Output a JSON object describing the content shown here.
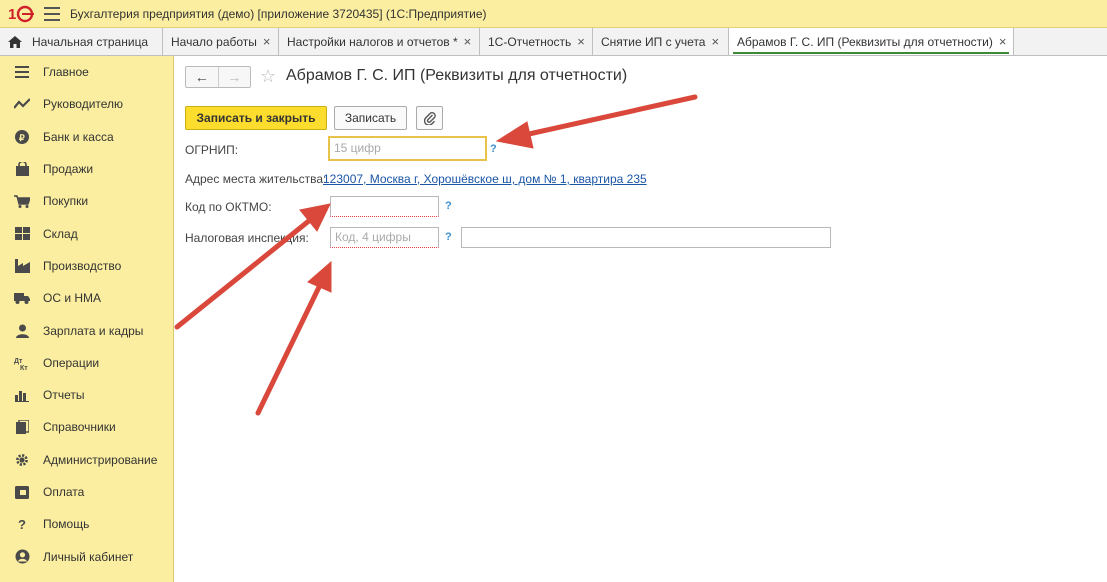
{
  "app": {
    "title": "Бухгалтерия предприятия (демо) [приложение 3720435]  (1С:Предприятие)"
  },
  "tabs": [
    {
      "label": "Начальная страница"
    },
    {
      "label": "Начало работы",
      "close": "×"
    },
    {
      "label": "Настройки налогов и отчетов *",
      "close": "×"
    },
    {
      "label": "1С-Отчетность",
      "close": "×"
    },
    {
      "label": "Снятие ИП с учета",
      "close": "×"
    },
    {
      "label": "Абрамов Г. С. ИП (Реквизиты для отчетности)",
      "close": "×"
    }
  ],
  "sidebar": {
    "items": [
      {
        "label": "Главное",
        "icon": "menu-icon"
      },
      {
        "label": "Руководителю",
        "icon": "chart-line-icon"
      },
      {
        "label": "Банк и касса",
        "icon": "coin-icon"
      },
      {
        "label": "Продажи",
        "icon": "bag-icon"
      },
      {
        "label": "Покупки",
        "icon": "cart-icon"
      },
      {
        "label": "Склад",
        "icon": "grid-icon"
      },
      {
        "label": "Производство",
        "icon": "factory-icon"
      },
      {
        "label": "ОС и НМА",
        "icon": "truck-icon"
      },
      {
        "label": "Зарплата и кадры",
        "icon": "person-icon"
      },
      {
        "label": "Операции",
        "icon": "debit-credit-icon"
      },
      {
        "label": "Отчеты",
        "icon": "bar-chart-icon"
      },
      {
        "label": "Справочники",
        "icon": "books-icon"
      },
      {
        "label": "Администрирование",
        "icon": "gear-icon"
      },
      {
        "label": "Оплата",
        "icon": "wallet-icon"
      },
      {
        "label": "Помощь",
        "icon": "question-icon"
      },
      {
        "label": "Личный кабинет",
        "icon": "account-icon"
      }
    ]
  },
  "form": {
    "title": "Абрамов Г. С. ИП (Реквизиты для отчетности)",
    "nav_back": "←",
    "nav_forward": "→",
    "star": "☆",
    "save_close_label": "Записать и закрыть",
    "save_label": "Записать",
    "ogrnip": {
      "label": "ОГРНИП:",
      "placeholder": "15 цифр",
      "hint": "?"
    },
    "address": {
      "label": "Адрес места жительства:",
      "value": "123007, Москва г, Хорошёвское ш, дом № 1, квартира 235"
    },
    "oktmo": {
      "label": "Код по ОКТМО:",
      "value": "",
      "hint": "?"
    },
    "tax_office": {
      "label": "Налоговая инспекция:",
      "code_placeholder": "Код, 4 цифры",
      "name_value": "",
      "hint": "?"
    }
  },
  "colors": {
    "sidebar_bg": "#fbeea0",
    "primary_button": "#fcdc2c",
    "link": "#1a55a6",
    "annotation_arrow": "#d9483b",
    "active_tab_underline": "#3a8a3a"
  }
}
